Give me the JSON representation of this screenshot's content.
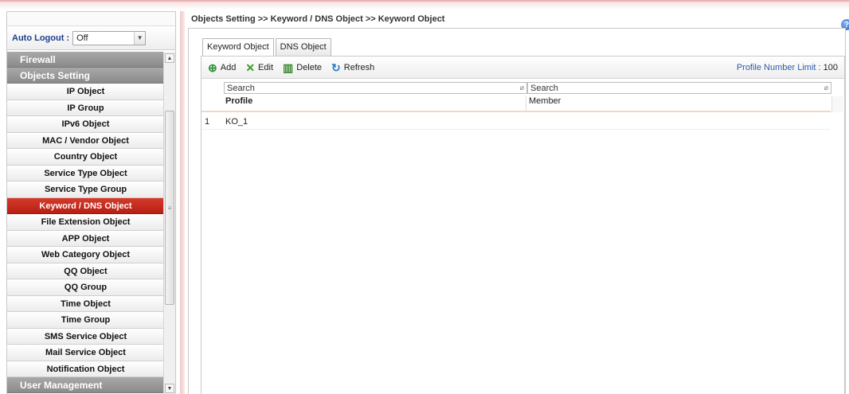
{
  "breadcrumb": "Objects Setting >> Keyword / DNS Object >> Keyword Object",
  "sidebar": {
    "auto_logout_label": "Auto Logout :",
    "auto_logout_value": "Off",
    "groups": {
      "firewall": "Firewall",
      "objects_setting": "Objects Setting",
      "user_management": "User Management"
    },
    "items": [
      "IP Object",
      "IP Group",
      "IPv6 Object",
      "MAC / Vendor Object",
      "Country Object",
      "Service Type Object",
      "Service Type Group",
      "Keyword / DNS Object",
      "File Extension Object",
      "APP Object",
      "Web Category Object",
      "QQ Object",
      "QQ Group",
      "Time Object",
      "Time Group",
      "SMS Service Object",
      "Mail Service Object",
      "Notification Object"
    ],
    "active_item": "Keyword / DNS Object"
  },
  "tabs": [
    "Keyword Object",
    "DNS Object"
  ],
  "toolbar": {
    "add": "Add",
    "edit": "Edit",
    "delete": "Delete",
    "refresh": "Refresh",
    "limit_label": "Profile Number Limit :",
    "limit_value": "100"
  },
  "table": {
    "search_placeholder_profile": "Search",
    "search_placeholder_member": "Search",
    "columns": [
      "Profile",
      "Member"
    ],
    "rows": [
      {
        "index": "1",
        "profile": "KO_1",
        "member": ""
      }
    ]
  },
  "colors": {
    "active_menu": "#c62a1e",
    "group_header": "#9a9a9a",
    "link_blue": "#2c5ea8"
  }
}
